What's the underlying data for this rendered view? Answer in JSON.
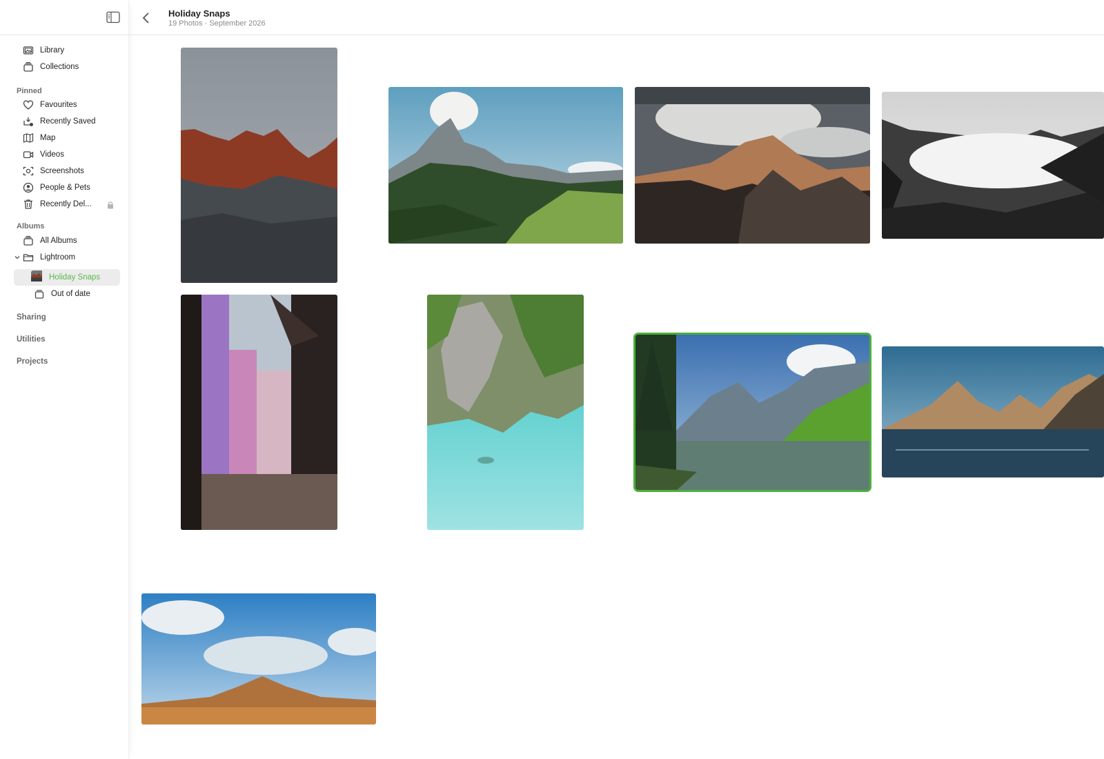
{
  "header": {
    "title": "Holiday Snaps",
    "subtitle": "19 Photos · September 2026"
  },
  "sidebar": {
    "top_items": [
      {
        "label": "Library",
        "icon": "photo-library-icon"
      },
      {
        "label": "Collections",
        "icon": "collections-icon"
      }
    ],
    "pinned_label": "Pinned",
    "pinned_items": [
      {
        "label": "Favourites",
        "icon": "heart-icon"
      },
      {
        "label": "Recently Saved",
        "icon": "recently-saved-icon"
      },
      {
        "label": "Map",
        "icon": "map-icon"
      },
      {
        "label": "Videos",
        "icon": "video-icon"
      },
      {
        "label": "Screenshots",
        "icon": "screenshot-icon"
      },
      {
        "label": "People & Pets",
        "icon": "person-icon"
      },
      {
        "label": "Recently Del...",
        "icon": "trash-icon"
      }
    ],
    "albums_label": "Albums",
    "album_items": [
      {
        "label": "All Albums",
        "icon": "albums-icon"
      },
      {
        "label": "Lightroom",
        "icon": "folder-icon"
      },
      {
        "label": "Holiday Snaps",
        "icon": "album-thumbnail"
      },
      {
        "label": "Out of date",
        "icon": "album-icon"
      }
    ],
    "sharing_label": "Sharing",
    "utilities_label": "Utilities",
    "projects_label": "Projects"
  },
  "colors": {
    "accent": "#4caf3b",
    "selected_text": "#5bb84a"
  },
  "photos": [
    {
      "name": "red-peaks"
    },
    {
      "name": "alpine-valley"
    },
    {
      "name": "cloudy-summit"
    },
    {
      "name": "misty-hills"
    },
    {
      "name": "colorful-alley"
    },
    {
      "name": "turquoise-cove"
    },
    {
      "name": "mountain-lake"
    },
    {
      "name": "fjord-peaks"
    },
    {
      "name": "desert-hill"
    }
  ],
  "selected_photo": "mountain-lake"
}
